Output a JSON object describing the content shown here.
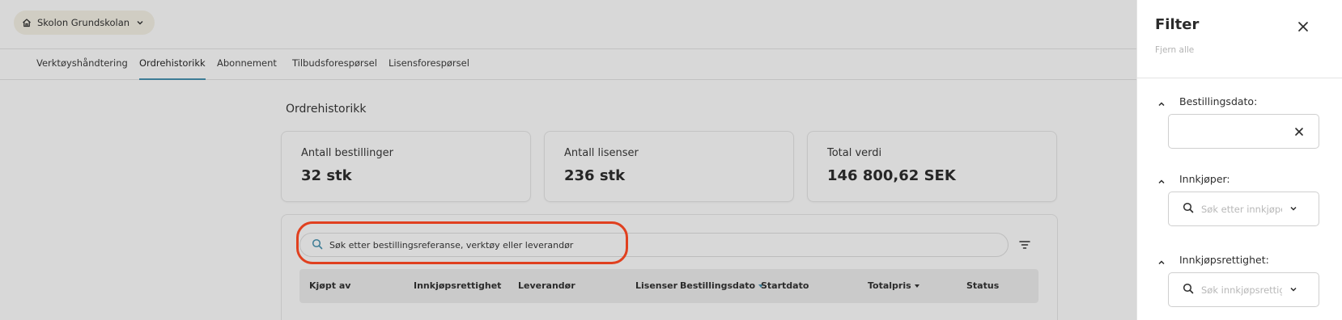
{
  "header": {
    "school": "Skolon Grundskolan"
  },
  "tabs": [
    {
      "label": "Verktøyshåndtering"
    },
    {
      "label": "Ordrehistorikk"
    },
    {
      "label": "Abonnement"
    },
    {
      "label": "Tilbudsforespørsel"
    },
    {
      "label": "Lisensforespørsel"
    }
  ],
  "page": {
    "title": "Ordrehistorikk"
  },
  "stats": [
    {
      "label": "Antall bestillinger",
      "value": "32 stk"
    },
    {
      "label": "Antall lisenser",
      "value": "236 stk"
    },
    {
      "label": "Total verdi",
      "value": "146 800,62 SEK"
    }
  ],
  "search": {
    "text": "Søk etter bestillingsreferanse, verktøy eller leverandør"
  },
  "table": {
    "columns": [
      "Kjøpt av",
      "Innkjøpsrettighet",
      "Leverandør",
      "Lisenser",
      "Bestillingsdato",
      "Startdato",
      "Totalpris",
      "Status"
    ]
  },
  "filter": {
    "title": "Filter",
    "clear_all": "Fjern alle",
    "sections": [
      {
        "label": "Bestillingsdato:"
      },
      {
        "label": "Innkjøper:",
        "placeholder": "Søk etter innkjøper"
      },
      {
        "label": "Innkjøpsrettighet:",
        "placeholder": "Søk innkjøpsrettighet"
      }
    ]
  },
  "colors": {
    "accent": "#3d7c95",
    "highlight": "#e0401f",
    "overlay_bg": "#d8d8d8"
  },
  "icons": {
    "home": "home-icon",
    "chevron": "chevron-down-icon",
    "search": "search-icon",
    "filter": "filter-icon",
    "close": "close-icon"
  }
}
